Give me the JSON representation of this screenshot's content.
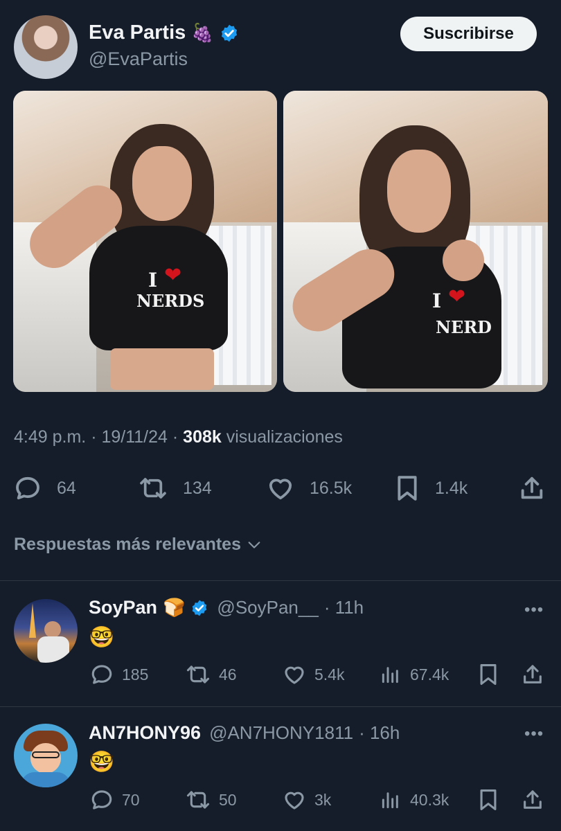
{
  "post": {
    "author_name": "Eva Partis",
    "author_emoji": "🍇",
    "author_handle": "@EvaPartis",
    "subscribe_label": "Suscribirse",
    "photo_text_1": "NERDS",
    "photo_text_2": "NERD",
    "photo_text_i": "I",
    "time": "4:49 p.m.",
    "date": "19/11/24",
    "views": "308k",
    "views_label": "visualizaciones",
    "separator": "·",
    "stats": {
      "replies": "64",
      "reposts": "134",
      "likes": "16.5k",
      "bookmarks": "1.4k"
    }
  },
  "replies_sort_label": "Respuestas más relevantes",
  "replies": [
    {
      "name": "SoyPan",
      "name_emoji": "🍞",
      "handle": "@SoyPan__",
      "time": "· 11h",
      "content_emoji": "🤓",
      "more": "•••",
      "stats": {
        "replies": "185",
        "reposts": "46",
        "likes": "5.4k",
        "views": "67.4k"
      }
    },
    {
      "name": "AN7HONY96",
      "handle": "@AN7HONY1811",
      "time": "· 16h",
      "content_emoji": "🤓",
      "more": "•••",
      "stats": {
        "replies": "70",
        "reposts": "50",
        "likes": "3k",
        "views": "40.3k"
      }
    }
  ],
  "colors": {
    "background": "#161d2a",
    "verified": "#1d9bf0",
    "muted": "#8b98a5",
    "text": "#e7e9ea"
  }
}
